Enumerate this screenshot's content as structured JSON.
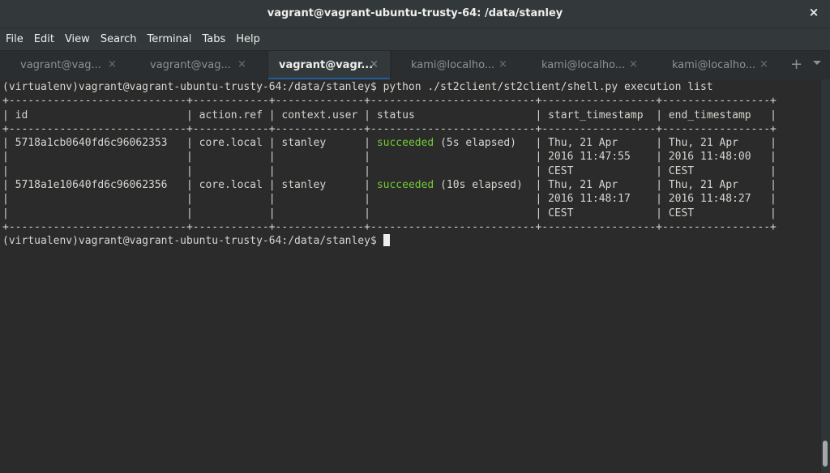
{
  "window": {
    "title": "vagrant@vagrant-ubuntu-trusty-64: /data/stanley",
    "close_icon": "×"
  },
  "menu": [
    "File",
    "Edit",
    "View",
    "Search",
    "Terminal",
    "Tabs",
    "Help"
  ],
  "tabs": [
    {
      "label": "vagrant@vag...",
      "active": false
    },
    {
      "label": "vagrant@vag...",
      "active": false
    },
    {
      "label": "vagrant@vagr...",
      "active": true
    },
    {
      "label": "kami@localho...",
      "active": false
    },
    {
      "label": "kami@localho...",
      "active": false
    },
    {
      "label": "kami@localho...",
      "active": false
    }
  ],
  "tab_close_glyph": "×",
  "new_tab_glyph": "+",
  "terminal": {
    "prompt": "(virtualenv)vagrant@vagrant-ubuntu-trusty-64:/data/stanley$",
    "command": "python ./st2client/st2client/shell.py execution list",
    "table": {
      "border": "+----------------------------+------------+--------------+--------------------------+------------------+-----------------+",
      "headers": [
        "id",
        "action.ref",
        "context.user",
        "status",
        "start_timestamp",
        "end_timestamp"
      ],
      "rows": [
        {
          "id": "5718a1cb0640fd6c96062353",
          "action_ref": "core.local",
          "context_user": "stanley",
          "status": "succeeded",
          "elapsed": "(5s elapsed)",
          "start_timestamp": [
            "Thu, 21 Apr",
            "2016 11:47:55",
            "CEST"
          ],
          "end_timestamp": [
            "Thu, 21 Apr",
            "2016 11:48:00",
            "CEST"
          ]
        },
        {
          "id": "5718a1e10640fd6c96062356",
          "action_ref": "core.local",
          "context_user": "stanley",
          "status": "succeeded",
          "elapsed": "(10s elapsed)",
          "start_timestamp": [
            "Thu, 21 Apr",
            "2016 11:48:17",
            "CEST"
          ],
          "end_timestamp": [
            "Thu, 21 Apr",
            "2016 11:48:27",
            "CEST"
          ]
        }
      ]
    },
    "status_color": "#73c936"
  }
}
